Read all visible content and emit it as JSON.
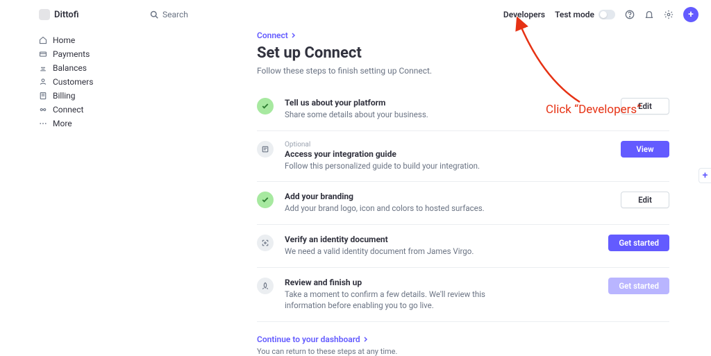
{
  "brand": "Dittofi",
  "search_placeholder": "Search",
  "header": {
    "developers": "Developers",
    "test_mode": "Test mode"
  },
  "sidebar": {
    "items": [
      {
        "label": "Home"
      },
      {
        "label": "Payments"
      },
      {
        "label": "Balances"
      },
      {
        "label": "Customers"
      },
      {
        "label": "Billing"
      },
      {
        "label": "Connect"
      },
      {
        "label": "More"
      }
    ]
  },
  "breadcrumb": "Connect",
  "page_title": "Set up Connect",
  "page_subtitle": "Follow these steps to finish setting up Connect.",
  "steps": [
    {
      "title": "Tell us about your platform",
      "desc": "Share some details about your business.",
      "action": "Edit"
    },
    {
      "optional": "Optional",
      "title": "Access your integration guide",
      "desc": "Follow this personalized guide to build your integration.",
      "action": "View"
    },
    {
      "title": "Add your branding",
      "desc": "Add your brand logo, icon and colors to hosted surfaces.",
      "action": "Edit"
    },
    {
      "title": "Verify an identity document",
      "desc": "We need a valid identity document from James Virgo.",
      "action": "Get started"
    },
    {
      "title": "Review and finish up",
      "desc": "Take a moment to confirm a few details. We'll review this information before enabling you to go live.",
      "action": "Get started"
    }
  ],
  "footer_link": "Continue to your dashboard",
  "footer_note": "You can return to these steps at any time.",
  "annotation": "Click “Developers”"
}
